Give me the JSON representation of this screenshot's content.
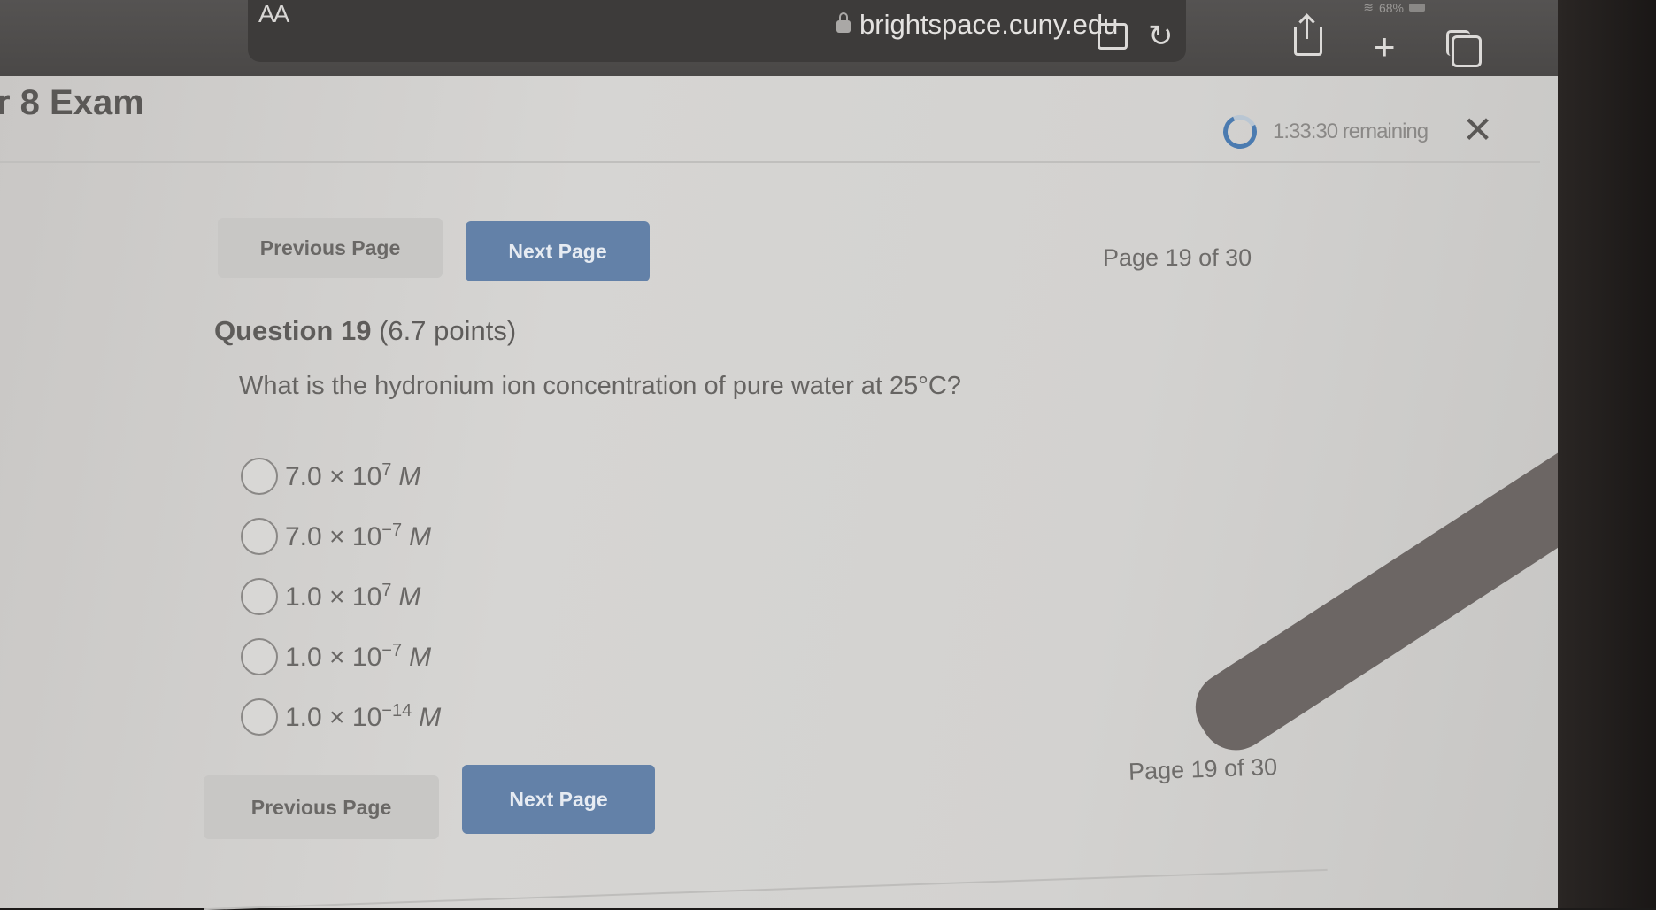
{
  "browser": {
    "text_size_label": "AA",
    "url": "brightspace.cuny.edu",
    "battery": "68%",
    "icons": [
      "lock-icon",
      "extension-icon",
      "reload-icon",
      "share-icon",
      "new-tab-icon",
      "tabs-icon"
    ]
  },
  "exam": {
    "title": "r 8 Exam",
    "timer": "1:33:30 remaining",
    "close_label": "X"
  },
  "navigation": {
    "previous_label": "Previous Page",
    "next_label": "Next Page",
    "page_indicator": "Page 19 of 30"
  },
  "question": {
    "heading": "Question 19",
    "points": "(6.7 points)",
    "text": "What is the hydronium ion concentration of pure water at 25°C?",
    "options": [
      {
        "mantissa": "7.0 × 10",
        "exponent": "7",
        "unit": "M",
        "selected": false
      },
      {
        "mantissa": "7.0 × 10",
        "exponent": "−7",
        "unit": "M",
        "selected": false
      },
      {
        "mantissa": "1.0 × 10",
        "exponent": "7",
        "unit": "M",
        "selected": false
      },
      {
        "mantissa": "1.0 × 10",
        "exponent": "−7",
        "unit": "M",
        "selected": false
      },
      {
        "mantissa": "1.0 × 10",
        "exponent": "−14",
        "unit": "M",
        "selected": false
      }
    ]
  }
}
